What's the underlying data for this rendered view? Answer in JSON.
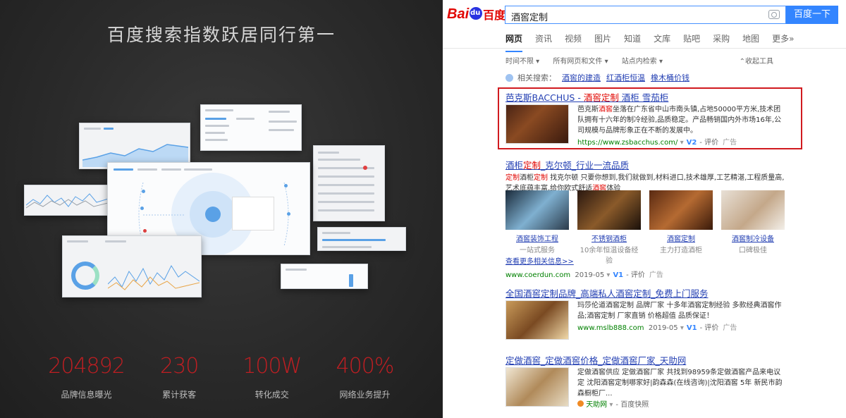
{
  "promo": {
    "title": "百度搜索指数跃居同行第一",
    "stats": [
      {
        "value": "204892",
        "label": "品牌信息曝光"
      },
      {
        "value": "230",
        "label": "累计获客"
      },
      {
        "value": "100W",
        "label": "转化成交"
      },
      {
        "value": "400%",
        "label": "网络业务提升"
      }
    ]
  },
  "baidu": {
    "logo_text": "Bai",
    "logo_cn": "百度",
    "search_value": "酒窖定制",
    "search_button": "百度一下",
    "tabs": [
      "网页",
      "资讯",
      "视频",
      "图片",
      "知道",
      "文库",
      "贴吧",
      "采购",
      "地图",
      "更多»"
    ],
    "filters": [
      "时间不限 ▾",
      "所有网页和文件 ▾",
      "站点内检索 ▾"
    ],
    "filter_right": "⌃收起工具",
    "related_label": "相关搜索：",
    "related_links": [
      "酒窖的建造",
      "红酒柜恒温",
      "橡木桶价钱"
    ],
    "results": [
      {
        "title_pre": "芭克斯BACCHUS - ",
        "title_em": "酒窖定制",
        "title_post": " 酒柜 雪茄柜",
        "body_pre": "芭克斯",
        "body_em": "酒窖",
        "body_post": "坐落在广东省中山市南头镇,占地50000平方米,技术团队拥有十六年的制冷经验,品质稳定。产品畅销国内外市场16年,公司规模与品牌形象正在不断的发展中。",
        "url": "https://www.zsbacchus.com/",
        "badge": "V2",
        "rate": "- 评价",
        "ad": "广告"
      },
      {
        "title_pre": "酒柜",
        "title_em": "定制",
        "title_post": "_克尔顿_行业一流品质",
        "body_em1": "定制",
        "body_mid1": "酒柜",
        "body_em2": "定制",
        "body_post": " 找克尔顿 只要你想到,我们就做到,材料进口,技术雄厚,工艺精湛,工程质量高,艺术底蕴丰富,给你欧式舒适",
        "body_em3": "酒窖",
        "body_end": "体验",
        "images": [
          {
            "caption": "酒窖装饰工程",
            "sub": "一站式服务"
          },
          {
            "caption": "不锈钢酒柜",
            "sub": "10余年恒温设备经验"
          },
          {
            "caption": "酒窖定制",
            "sub": "主力打造酒柜"
          },
          {
            "caption": "酒窖制冷设备",
            "sub": "口碑极佳"
          }
        ],
        "more": "查看更多相关信息>>",
        "url": "www.coerdun.com",
        "date": "2019-05",
        "badge": "V1",
        "rate": "- 评价",
        "ad": "广告"
      },
      {
        "title": "全国酒窖定制品牌_高端私人酒窖定制_免费上门服务",
        "body": "玛莎伦道酒窖定制 品牌厂家 十多年酒窖定制经验 多款经典酒窖作品;酒窖定制 厂家直销 价格超值 品质保证！",
        "url": "www.mslb888.com",
        "date": "2019-05",
        "badge": "V1",
        "rate": "- 评价",
        "ad": "广告"
      },
      {
        "title": "定做酒窖_定做酒窖价格_定做酒窖厂家_天助网",
        "body": "定做酒窖供应 定做酒窖厂家 共找到98959条定做酒窖产品来电议定 沈阳酒窖定制哪家好|韵森森(在线咨询)|沈阳酒窖 5年 新民市韵森橱柜厂...",
        "source": "天助网",
        "snapshot": "- 百度快照"
      }
    ]
  }
}
